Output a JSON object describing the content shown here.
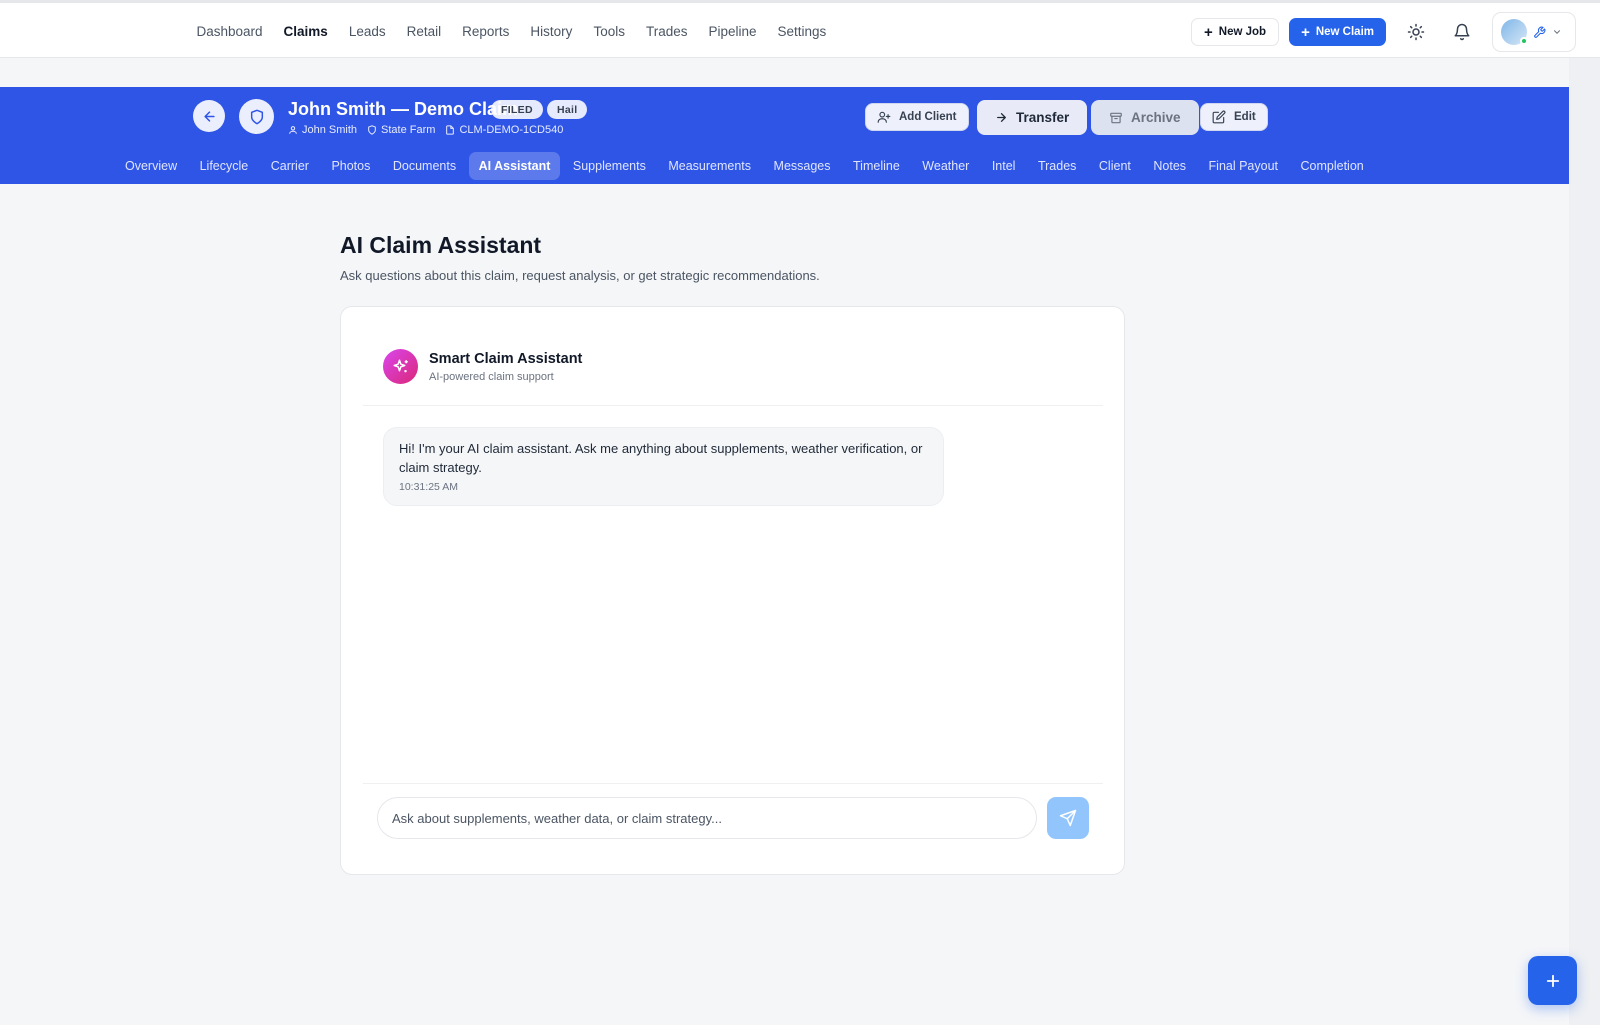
{
  "nav": {
    "items": [
      {
        "label": "Dashboard",
        "active": false
      },
      {
        "label": "Claims",
        "active": true
      },
      {
        "label": "Leads",
        "active": false
      },
      {
        "label": "Retail",
        "active": false
      },
      {
        "label": "Reports",
        "active": false
      },
      {
        "label": "History",
        "active": false
      },
      {
        "label": "Tools",
        "active": false
      },
      {
        "label": "Trades",
        "active": false
      },
      {
        "label": "Pipeline",
        "active": false
      },
      {
        "label": "Settings",
        "active": false
      }
    ],
    "new_job_label": "New Job",
    "new_claim_label": "New Claim"
  },
  "claim": {
    "title": "John Smith — Demo Claim",
    "status_badge": "FILED",
    "type_badge": "Hail",
    "client_name": "John Smith",
    "carrier": "State Farm",
    "claim_number": "CLM-DEMO-1CD540",
    "actions": {
      "add_client": "Add Client",
      "transfer": "Transfer",
      "archive": "Archive",
      "edit": "Edit"
    },
    "tabs": [
      {
        "label": "Overview",
        "active": false
      },
      {
        "label": "Lifecycle",
        "active": false
      },
      {
        "label": "Carrier",
        "active": false
      },
      {
        "label": "Photos",
        "active": false
      },
      {
        "label": "Documents",
        "active": false
      },
      {
        "label": "AI Assistant",
        "active": true
      },
      {
        "label": "Supplements",
        "active": false
      },
      {
        "label": "Measurements",
        "active": false
      },
      {
        "label": "Messages",
        "active": false
      },
      {
        "label": "Timeline",
        "active": false
      },
      {
        "label": "Weather",
        "active": false
      },
      {
        "label": "Intel",
        "active": false
      },
      {
        "label": "Trades",
        "active": false
      },
      {
        "label": "Client",
        "active": false
      },
      {
        "label": "Notes",
        "active": false
      },
      {
        "label": "Final Payout",
        "active": false
      },
      {
        "label": "Completion",
        "active": false
      }
    ]
  },
  "main": {
    "title": "AI Claim Assistant",
    "subtitle": "Ask questions about this claim, request analysis, or get strategic recommendations."
  },
  "assistant": {
    "name": "Smart Claim Assistant",
    "tagline": "AI-powered claim support",
    "messages": [
      {
        "text": "Hi! I'm your AI claim assistant. Ask me anything about supplements, weather verification, or claim strategy.",
        "time": "10:31:25 AM"
      }
    ],
    "input_placeholder": "Ask about supplements, weather data, or claim strategy...",
    "input_value": ""
  },
  "icons": {
    "theme": "sun-icon",
    "notifications": "bell-icon",
    "back": "arrow-left-icon",
    "shield": "shield-icon",
    "send": "send-icon",
    "fab": "plus-icon"
  },
  "colors": {
    "brand_blue": "#2f55e6",
    "primary_button": "#2563eb",
    "ai_gradient_start": "#d946ef",
    "ai_gradient_end": "#db2777",
    "online_dot": "#22c55e"
  }
}
